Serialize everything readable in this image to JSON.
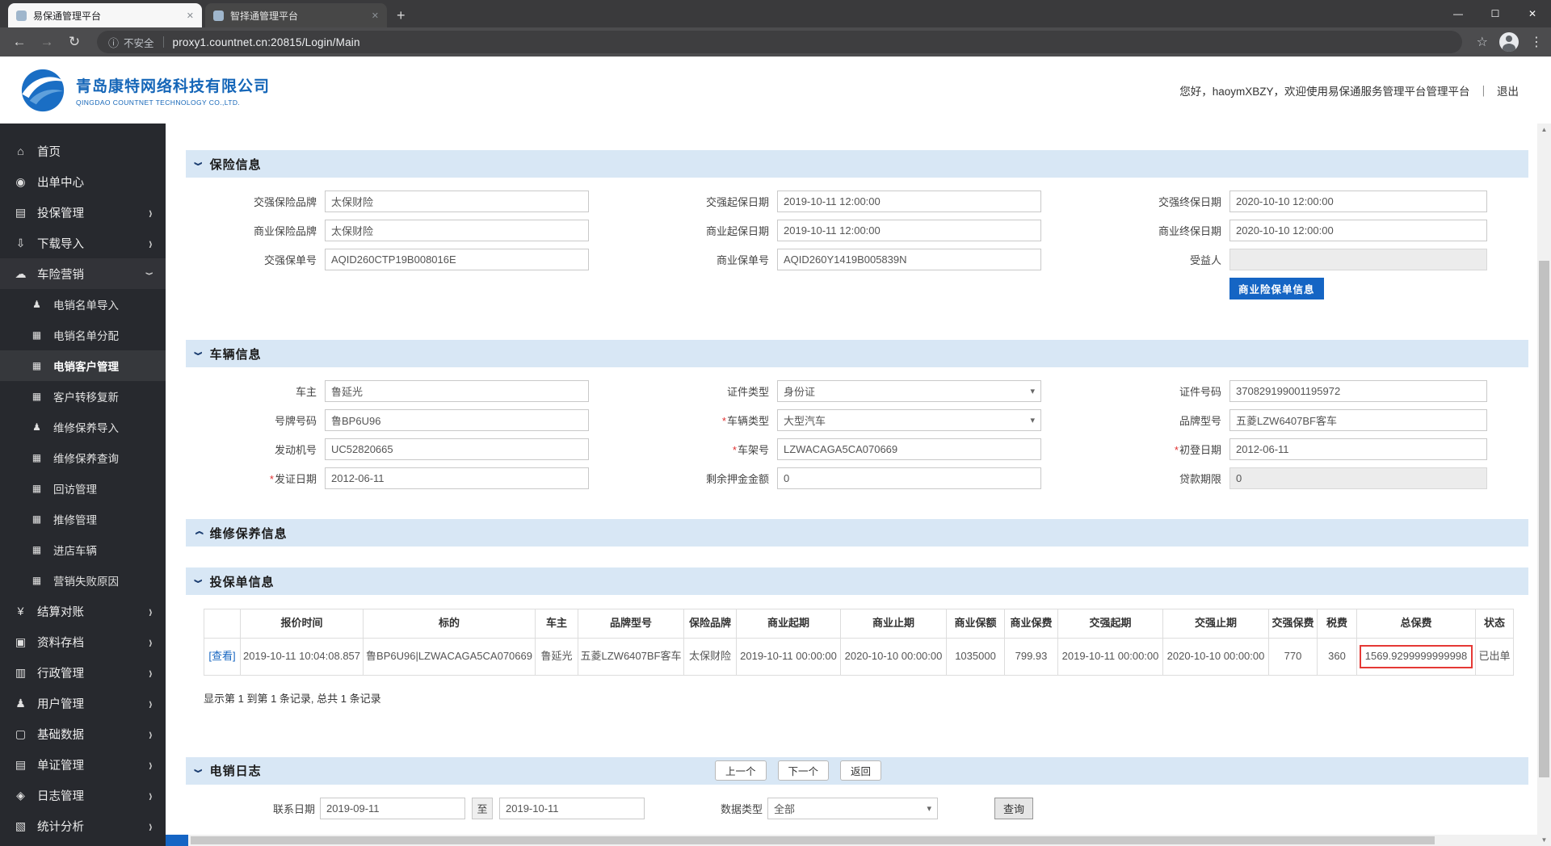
{
  "browser": {
    "tabs": [
      {
        "title": "易保通管理平台"
      },
      {
        "title": "智择通管理平台"
      }
    ],
    "security_label": "不安全",
    "url": "proxy1.countnet.cn:20815/Login/Main",
    "icons": {
      "back": "←",
      "forward": "→",
      "reload": "↻",
      "info": "ⓘ",
      "star": "☆",
      "menu": "⋮",
      "new_tab": "+",
      "tab_close": "✕",
      "minimize": "—",
      "maximize": "☐",
      "close": "✕"
    }
  },
  "header": {
    "company_cn": "青岛康特网络科技有限公司",
    "company_en": "QINGDAO COUNTNET TECHNOLOGY CO.,LTD.",
    "welcome": "您好，haoymXBZY，欢迎使用易保通服务管理平台管理平台",
    "divider": "｜",
    "logout": "退出"
  },
  "marks": {
    "required": "*",
    "chevron": "›",
    "select_arrow": "▾",
    "scroll_up": "▲",
    "scroll_down": "▼"
  },
  "sidebar": {
    "items": [
      {
        "label": "首页",
        "glyph": "⌂"
      },
      {
        "label": "出单中心",
        "glyph": "◉"
      },
      {
        "label": "投保管理",
        "glyph": "▤"
      },
      {
        "label": "下载导入",
        "glyph": "⇩"
      },
      {
        "label": "车险营销",
        "glyph": "☁"
      },
      {
        "label": "电销名单导入",
        "glyph": "♟"
      },
      {
        "label": "电销名单分配",
        "glyph": "▦"
      },
      {
        "label": "电销客户管理",
        "glyph": "▦"
      },
      {
        "label": "客户转移复新",
        "glyph": "▦"
      },
      {
        "label": "维修保养导入",
        "glyph": "♟"
      },
      {
        "label": "维修保养查询",
        "glyph": "▦"
      },
      {
        "label": "回访管理",
        "glyph": "▦"
      },
      {
        "label": "推修管理",
        "glyph": "▦"
      },
      {
        "label": "进店车辆",
        "glyph": "▦"
      },
      {
        "label": "营销失败原因",
        "glyph": "▦"
      },
      {
        "label": "结算对账",
        "glyph": "¥"
      },
      {
        "label": "资料存档",
        "glyph": "▣"
      },
      {
        "label": "行政管理",
        "glyph": "▥"
      },
      {
        "label": "用户管理",
        "glyph": "♟"
      },
      {
        "label": "基础数据",
        "glyph": "▢"
      },
      {
        "label": "单证管理",
        "glyph": "▤"
      },
      {
        "label": "日志管理",
        "glyph": "◈"
      },
      {
        "label": "统计分析",
        "glyph": "▧"
      }
    ]
  },
  "sections": {
    "insurance": {
      "title": "保险信息",
      "fields": [
        {
          "label": "交强保险品牌",
          "value": "太保财险"
        },
        {
          "label": "交强起保日期",
          "value": "2019-10-11 12:00:00"
        },
        {
          "label": "交强终保日期",
          "value": "2020-10-10 12:00:00"
        },
        {
          "label": "商业保险品牌",
          "value": "太保财险"
        },
        {
          "label": "商业起保日期",
          "value": "2019-10-11 12:00:00"
        },
        {
          "label": "商业终保日期",
          "value": "2020-10-10 12:00:00"
        },
        {
          "label": "交强保单号",
          "value": "AQID260CTP19B008016E"
        },
        {
          "label": "商业保单号",
          "value": "AQID260Y1419B005839N"
        },
        {
          "label": "受益人",
          "value": ""
        }
      ],
      "button": "商业险保单信息"
    },
    "vehicle": {
      "title": "车辆信息",
      "fields": [
        {
          "label": "车主",
          "value": "鲁延光"
        },
        {
          "label": "证件类型",
          "value": "身份证"
        },
        {
          "label": "证件号码",
          "value": "370829199001195972"
        },
        {
          "label": "号牌号码",
          "value": "鲁BP6U96"
        },
        {
          "label": "车辆类型",
          "value": "大型汽车"
        },
        {
          "label": "品牌型号",
          "value": "五菱LZW6407BF客车"
        },
        {
          "label": "发动机号",
          "value": "UC52820665"
        },
        {
          "label": "车架号",
          "value": "LZWACAGA5CA070669"
        },
        {
          "label": "初登日期",
          "value": "2012-06-11"
        },
        {
          "label": "发证日期",
          "value": "2012-06-11"
        },
        {
          "label": "剩余押金金额",
          "value": "0"
        },
        {
          "label": "贷款期限",
          "value": "0"
        }
      ]
    },
    "maintenance": {
      "title": "维修保养信息"
    },
    "policy": {
      "title": "投保单信息",
      "table": {
        "headers": [
          "",
          "报价时间",
          "标的",
          "车主",
          "品牌型号",
          "保险品牌",
          "商业起期",
          "商业止期",
          "商业保额",
          "商业保费",
          "交强起期",
          "交强止期",
          "交强保费",
          "税费",
          "总保费",
          "状态"
        ],
        "row": [
          "[查看]",
          "2019-10-11 10:04:08.857",
          "鲁BP6U96|LZWACAGA5CA070669",
          "鲁延光",
          "五菱LZW6407BF客车",
          "太保财险",
          "2019-10-11 00:00:00",
          "2020-10-10 00:00:00",
          "1035000",
          "799.93",
          "2019-10-11 00:00:00",
          "2020-10-10 00:00:00",
          "770",
          "360",
          "1569.9299999999998",
          "已出单"
        ]
      },
      "summary": "显示第 1 到第 1 条记录, 总共 1 条记录"
    },
    "telelog": {
      "title": "电销日志",
      "prev": "上一个",
      "next": "下一个",
      "back": "返回",
      "contact_date_label": "联系日期",
      "date_from": "2019-09-11",
      "to": "至",
      "date_to": "2019-10-11",
      "data_type_label": "数据类型",
      "data_type_value": "全部",
      "query": "查询"
    }
  },
  "colors": {
    "accent_blue": "#1565c4",
    "section_bar": "#d8e7f5",
    "alert_red": "#e53935",
    "sidebar_bg": "#27292e"
  }
}
